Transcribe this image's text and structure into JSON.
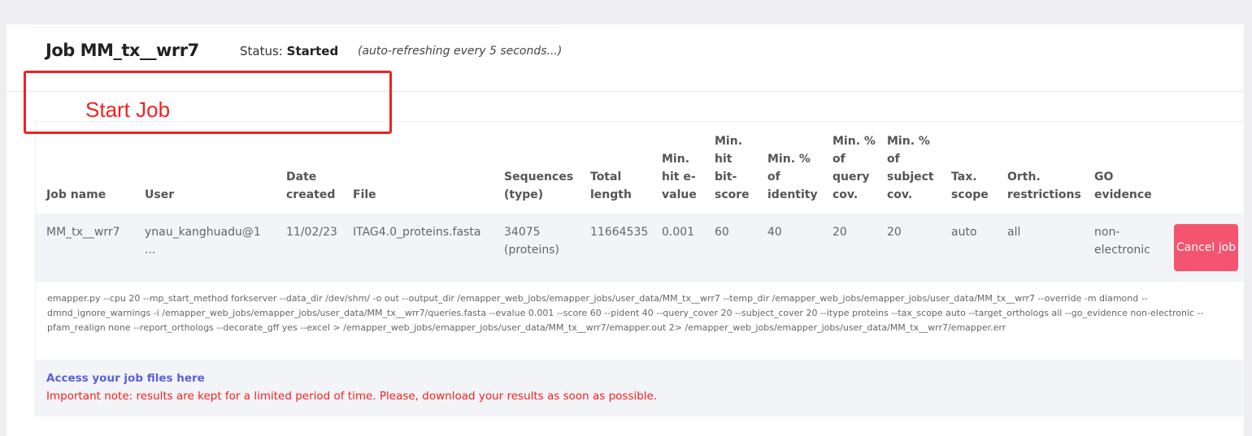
{
  "header": {
    "title": "Job MM_tx__wrr7",
    "status_label": "Status:",
    "status_value": "Started",
    "refresh_note": "(auto-refreshing every 5 seconds...)"
  },
  "annotation": {
    "label": "Start Job",
    "color": "#f42020"
  },
  "table": {
    "headers": [
      "Job name",
      "User",
      "Date created",
      "File",
      "Sequences (type)",
      "Total length",
      "Min. hit e-value",
      "Min. hit bit-score",
      "Min. % of identity",
      "Min. % of query cov.",
      "Min. % of subject cov.",
      "Tax. scope",
      "Orth. restrictions",
      "GO evidence"
    ],
    "row": [
      "MM_tx__wrr7",
      "ynau_kanghuadu@1 ...",
      "11/02/23",
      "ITAG4.0_proteins.fasta",
      "34075 (proteins)",
      "11664535",
      "0.001",
      "60",
      "40",
      "20",
      "20",
      "auto",
      "all",
      "non-electronic"
    ],
    "cancel_label": "Cancel job"
  },
  "command": "emapper.py --cpu 20 --mp_start_method forkserver --data_dir /dev/shm/ -o out --output_dir /emapper_web_jobs/emapper_jobs/user_data/MM_tx__wrr7 --temp_dir /emapper_web_jobs/emapper_jobs/user_data/MM_tx__wrr7 --override -m diamond --dmnd_ignore_warnings -i /emapper_web_jobs/emapper_jobs/user_data/MM_tx__wrr7/queries.fasta --evalue 0.001 --score 60 --pident 40 --query_cover 20 --subject_cover 20 --itype proteins --tax_scope auto --target_orthologs all --go_evidence non-electronic --pfam_realign none --report_orthologs --decorate_gff yes --excel > /emapper_web_jobs/emapper_jobs/user_data/MM_tx__wrr7/emapper.out 2> /emapper_web_jobs/emapper_jobs/user_data/MM_tx__wrr7/emapper.err",
  "footer": {
    "link": "Access your job files here",
    "note": "Important note: results are kept for a limited period of time. Please, download your results as soon as possible."
  }
}
